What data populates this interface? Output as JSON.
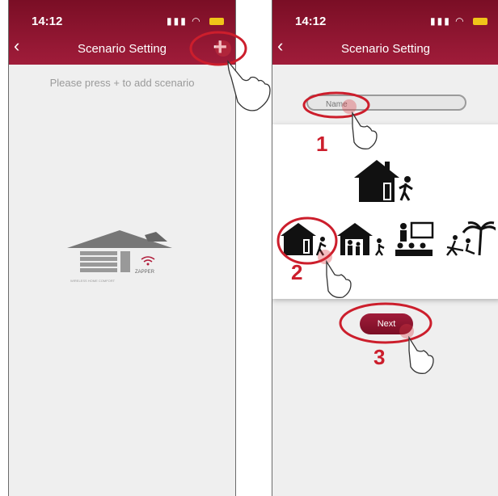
{
  "status": {
    "time": "14:12"
  },
  "header": {
    "title": "Scenario Setting"
  },
  "left": {
    "hint": "Please press + to add scenario",
    "plus_label": "+",
    "logo_text": "ZAPPER",
    "logo_subtext": "WIRELESS HOME COMFORT"
  },
  "right": {
    "name_placeholder": "Name",
    "next_label": "Next",
    "scenarios": [
      "leave-home",
      "arrive-home-family",
      "meeting",
      "vacation"
    ]
  },
  "annotations": {
    "step1": "1",
    "step2": "2",
    "step3": "3"
  },
  "colors": {
    "accent": "#8a1530",
    "annotation_red": "#cc1e2c",
    "battery": "#f0c419"
  }
}
